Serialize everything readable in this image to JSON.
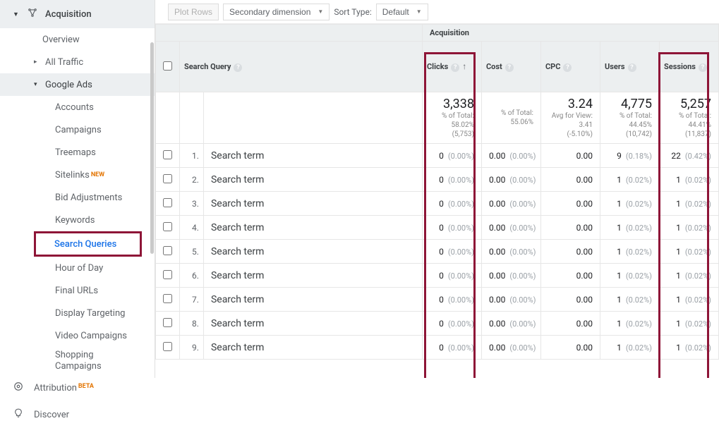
{
  "sidebar": {
    "section": "Acquisition",
    "items": {
      "overview": "Overview",
      "all_traffic": "All Traffic",
      "google_ads": "Google Ads",
      "accounts": "Accounts",
      "campaigns": "Campaigns",
      "treemaps": "Treemaps",
      "sitelinks": "Sitelinks",
      "bid_adjustments": "Bid Adjustments",
      "keywords": "Keywords",
      "search_queries": "Search Queries",
      "hour_of_day": "Hour of Day",
      "final_urls": "Final URLs",
      "display_targeting": "Display Targeting",
      "video_campaigns": "Video Campaigns",
      "shopping_campaigns": "Shopping Campaigns"
    },
    "bottom": {
      "attribution": "Attribution",
      "discover": "Discover"
    },
    "badges": {
      "new": "NEW",
      "beta": "BETA"
    }
  },
  "toolbar": {
    "plot_rows": "Plot Rows",
    "secondary_dimension": "Secondary dimension",
    "sort_type_label": "Sort Type:",
    "sort_type_value": "Default"
  },
  "table": {
    "group_header": "Acquisition",
    "primary_dim": "Search Query",
    "columns": {
      "clicks": "Clicks",
      "cost": "Cost",
      "cpc": "CPC",
      "users": "Users",
      "sessions": "Sessions"
    },
    "summary": {
      "clicks": {
        "value": "3,338",
        "sub1": "% of Total:",
        "sub2": "58.02%",
        "sub3": "(5,753)"
      },
      "cost": {
        "sub1": "% of Total: 55.06%"
      },
      "cpc": {
        "value": "3.24",
        "sub1": "Avg for View:",
        "sub2": "3.41",
        "sub3": "(-5.10%)"
      },
      "users": {
        "value": "4,775",
        "sub1": "% of Total:",
        "sub2": "44.45%",
        "sub3": "(10,742)"
      },
      "sessions": {
        "value": "5,257",
        "sub1": "% of Total:",
        "sub2": "44.41%",
        "sub3": "(11,837)"
      }
    },
    "rows": [
      {
        "i": "1.",
        "term": "Search term",
        "clicks": "0",
        "clicks_pct": "(0.00%)",
        "cost": "0.00",
        "cost_pct": "(0.00%)",
        "cpc": "0.00",
        "users": "9",
        "users_pct": "(0.18%)",
        "sessions": "22",
        "sessions_pct": "(0.42%)"
      },
      {
        "i": "2.",
        "term": "Search term",
        "clicks": "0",
        "clicks_pct": "(0.00%)",
        "cost": "0.00",
        "cost_pct": "(0.00%)",
        "cpc": "0.00",
        "users": "1",
        "users_pct": "(0.02%)",
        "sessions": "1",
        "sessions_pct": "(0.02%)"
      },
      {
        "i": "3.",
        "term": "Search term",
        "clicks": "0",
        "clicks_pct": "(0.00%)",
        "cost": "0.00",
        "cost_pct": "(0.00%)",
        "cpc": "0.00",
        "users": "1",
        "users_pct": "(0.02%)",
        "sessions": "1",
        "sessions_pct": "(0.02%)"
      },
      {
        "i": "4.",
        "term": "Search term",
        "clicks": "0",
        "clicks_pct": "(0.00%)",
        "cost": "0.00",
        "cost_pct": "(0.00%)",
        "cpc": "0.00",
        "users": "1",
        "users_pct": "(0.02%)",
        "sessions": "1",
        "sessions_pct": "(0.02%)"
      },
      {
        "i": "5.",
        "term": "Search term",
        "clicks": "0",
        "clicks_pct": "(0.00%)",
        "cost": "0.00",
        "cost_pct": "(0.00%)",
        "cpc": "0.00",
        "users": "1",
        "users_pct": "(0.02%)",
        "sessions": "1",
        "sessions_pct": "(0.02%)"
      },
      {
        "i": "6.",
        "term": "Search term",
        "clicks": "0",
        "clicks_pct": "(0.00%)",
        "cost": "0.00",
        "cost_pct": "(0.00%)",
        "cpc": "0.00",
        "users": "1",
        "users_pct": "(0.02%)",
        "sessions": "1",
        "sessions_pct": "(0.02%)"
      },
      {
        "i": "7.",
        "term": "Search term",
        "clicks": "0",
        "clicks_pct": "(0.00%)",
        "cost": "0.00",
        "cost_pct": "(0.00%)",
        "cpc": "0.00",
        "users": "1",
        "users_pct": "(0.02%)",
        "sessions": "1",
        "sessions_pct": "(0.02%)"
      },
      {
        "i": "8.",
        "term": "Search term",
        "clicks": "0",
        "clicks_pct": "(0.00%)",
        "cost": "0.00",
        "cost_pct": "(0.00%)",
        "cpc": "0.00",
        "users": "1",
        "users_pct": "(0.02%)",
        "sessions": "1",
        "sessions_pct": "(0.02%)"
      },
      {
        "i": "9.",
        "term": "Search term",
        "clicks": "0",
        "clicks_pct": "(0.00%)",
        "cost": "0.00",
        "cost_pct": "(0.00%)",
        "cpc": "0.00",
        "users": "1",
        "users_pct": "(0.02%)",
        "sessions": "1",
        "sessions_pct": "(0.02%)"
      }
    ]
  }
}
